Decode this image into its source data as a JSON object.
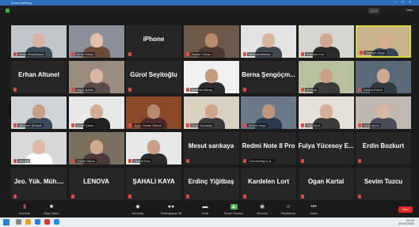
{
  "window": {
    "title": "Zoom Meeting"
  },
  "header": {
    "page_indicator": "1 / 2",
    "view_label": "View"
  },
  "tiles": [
    {
      "name": "",
      "sub": "Ercan Büyükkaya",
      "video": true,
      "skin": "#d6b3a0",
      "shirt": "#3a4a5a",
      "bg": "#bfc6cc"
    },
    {
      "name": "",
      "sub": "Nihal Göksu",
      "video": true,
      "skin": "#e0c0a8",
      "shirt": "#6b4a3a",
      "bg": "#8a8f99"
    },
    {
      "name": "iPhone",
      "sub": "",
      "video": false
    },
    {
      "name": "",
      "sub": "Hasan Yılmaz",
      "video": true,
      "skin": "#b98a6e",
      "shirt": "#4a3a30",
      "bg": "#6d5a4a"
    },
    {
      "name": "",
      "sub": "kemalçetinkaya",
      "video": true,
      "skin": "#d9b39b",
      "shirt": "#404850",
      "bg": "#e3e3e3"
    },
    {
      "name": "",
      "sub": "Hüseyin Kurt",
      "video": true,
      "skin": "#cfa88f",
      "shirt": "#2a2a2a",
      "bg": "#d6d6d0"
    },
    {
      "name": "",
      "sub": "Hüseyin Kaya",
      "video": true,
      "skin": "#d7ae93",
      "shirt": "#334455",
      "bg": "#c8b48a",
      "highlight": true
    },
    {
      "name": "Erhan Altunel",
      "sub": "",
      "video": false
    },
    {
      "name": "",
      "sub": "Aygül Şahin",
      "video": true,
      "skin": "#d8b8a2",
      "shirt": "#5a4a4a",
      "bg": "#9a8d80"
    },
    {
      "name": "Gürol Seyitoğlu",
      "sub": "",
      "video": false
    },
    {
      "name": "",
      "sub": "Mehmet Akbaş",
      "video": true,
      "skin": "#c49a80",
      "shirt": "#2a2a2a",
      "bg": "#f0f0f0"
    },
    {
      "name": "Berna Şengöçm...",
      "sub": "",
      "video": false
    },
    {
      "name": "",
      "sub": "Ali Ünal",
      "video": true,
      "skin": "#caa085",
      "shirt": "#3a3a3a",
      "bg": "#b8c0a0"
    },
    {
      "name": "",
      "sub": "Levent Ertürk",
      "video": true,
      "skin": "#d0a890",
      "shirt": "#2f3a40",
      "bg": "#5a6a7a"
    },
    {
      "name": "",
      "sub": "Mehmet Şimşek",
      "video": true,
      "skin": "#c8a088",
      "shirt": "#3a4a5a",
      "bg": "#cfd4d8"
    },
    {
      "name": "",
      "sub": "İsmail Şahin",
      "video": true,
      "skin": "#d4ac94",
      "shirt": "#222",
      "bg": "#e8e8e8"
    },
    {
      "name": "",
      "sub": "Ayşe Yılmaz Öztürk",
      "video": true,
      "skin": "#b88a70",
      "shirt": "#4a2a2a",
      "bg": "#8a4a2a"
    },
    {
      "name": "",
      "sub": "Ömer Kocabaş",
      "video": true,
      "skin": "#cfa58c",
      "shirt": "#3a3a3a",
      "bg": "#d8d0c0"
    },
    {
      "name": "",
      "sub": "Bülent Kaya",
      "video": true,
      "skin": "#c09478",
      "shirt": "#2a3a4a",
      "bg": "#6a7a8a"
    },
    {
      "name": "",
      "sub": "Halil Kara",
      "video": true,
      "skin": "#d4b09a",
      "shirt": "#3a3a3a",
      "bg": "#e4e0d8"
    },
    {
      "name": "",
      "sub": "Selin Aydın",
      "video": true,
      "skin": "#d8b8a0",
      "shirt": "#4a4a5a",
      "bg": "#c0b8b0"
    },
    {
      "name": "",
      "sub": "Nevzat",
      "video": true,
      "skin": "#e0b8a8",
      "shirt": "#ffffff",
      "bg": "#d8d8d8"
    },
    {
      "name": "",
      "sub": "Gülçin Yavuz",
      "video": true,
      "skin": "#d0a890",
      "shirt": "#4a3a3a",
      "bg": "#7a7060"
    },
    {
      "name": "",
      "sub": "Cemal Kılıç",
      "video": true,
      "skin": "#c8a088",
      "shirt": "#2a2a2a",
      "bg": "#e8e8e8"
    },
    {
      "name": "Mesut sarıkaya",
      "sub": "",
      "video": false
    },
    {
      "name": "Redmi Note 8 Pro",
      "sub": "Connecting to a...",
      "video": false
    },
    {
      "name": "Fulya Yücesoy E...",
      "sub": "",
      "video": false
    },
    {
      "name": "Erdin Bozkurt",
      "sub": "",
      "video": false
    },
    {
      "name": "Jeo. Yük. Müh....",
      "sub": "",
      "video": false
    },
    {
      "name": "LENOVA",
      "sub": "",
      "video": false
    },
    {
      "name": "ŞAHALI KAYA",
      "sub": "",
      "video": false
    },
    {
      "name": "Erdinç Yiğitbaş",
      "sub": "",
      "video": false
    },
    {
      "name": "Kardelen Lort",
      "sub": "",
      "video": false
    },
    {
      "name": "Ogan Kartal",
      "sub": "",
      "video": false
    },
    {
      "name": "Sevim Tuzcu",
      "sub": "",
      "video": false
    }
  ],
  "toolbar": {
    "unmute": "Unmute",
    "stop_video": "Stop Video",
    "security": "Security",
    "participants": "Participants",
    "participants_count": "35",
    "chat": "Chat",
    "share": "Share Screen",
    "record": "Record",
    "reactions": "Reactions",
    "more": "More",
    "end": "End"
  },
  "taskbar": {
    "time": "20:12",
    "date": "29.04.2021"
  }
}
